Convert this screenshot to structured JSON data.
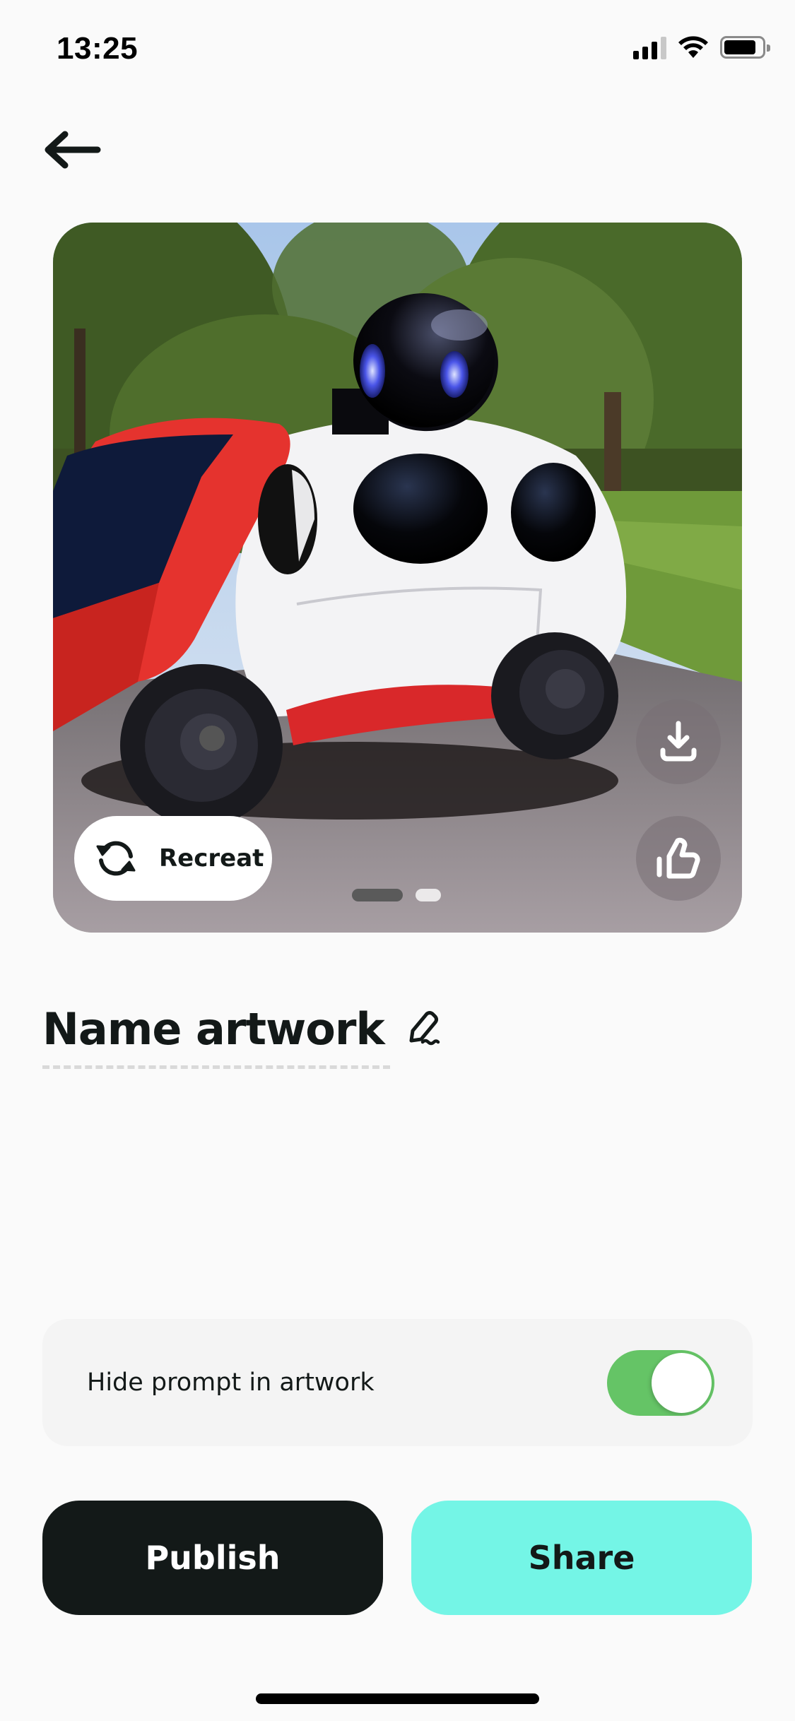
{
  "status_bar": {
    "time": "13:25",
    "signal_bars_filled": 3,
    "signal_bars_total": 4,
    "wifi": "wifi-icon",
    "battery_level": 0.85
  },
  "nav": {
    "back_icon": "arrow-left-icon"
  },
  "artwork": {
    "description": "AI-generated image of a red and white robot car with a black robot head in a park",
    "recreate_label": "Recreat",
    "recreate_icon": "refresh-icon",
    "download_icon": "download-icon",
    "like_icon": "thumbs-up-icon",
    "pagination": {
      "current": 1,
      "total": 2
    }
  },
  "title": {
    "text": "Name artwork",
    "edit_icon": "pencil-icon"
  },
  "settings": {
    "hide_prompt_label": "Hide prompt in artwork",
    "hide_prompt_enabled": true,
    "toggle_color": "#65c466"
  },
  "actions": {
    "publish_label": "Publish",
    "share_label": "Share",
    "publish_color": "#131918",
    "share_color": "#74f5e6"
  }
}
